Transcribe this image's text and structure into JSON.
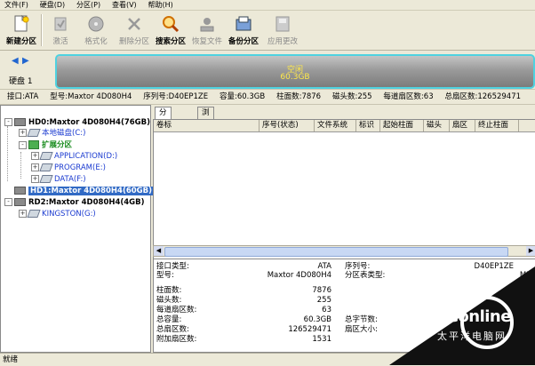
{
  "menu": [
    "文件(F)",
    "硬盘(D)",
    "分区(P)",
    "查看(V)",
    "帮助(H)"
  ],
  "toolbar": [
    {
      "label": "新建分区",
      "icon": "new-partition-icon",
      "enabled": true
    },
    {
      "label": "激活",
      "icon": "activate-icon",
      "enabled": false
    },
    {
      "label": "格式化",
      "icon": "format-icon",
      "enabled": false
    },
    {
      "label": "删除分区",
      "icon": "delete-partition-icon",
      "enabled": false
    },
    {
      "label": "搜索分区",
      "icon": "search-partition-icon",
      "enabled": true
    },
    {
      "label": "恢复文件",
      "icon": "restore-files-icon",
      "enabled": false
    },
    {
      "label": "备份分区",
      "icon": "backup-partition-icon",
      "enabled": true
    },
    {
      "label": "应用更改",
      "icon": "apply-changes-icon",
      "enabled": false
    }
  ],
  "diskbar": {
    "disk_label": "硬盘 1",
    "partition_name": "空闲",
    "partition_size": "60.3GB"
  },
  "infobar": [
    "接口:ATA",
    "型号:Maxtor 4D080H4",
    "序列号:D40EP1ZE",
    "容量:60.3GB",
    "柱面数:7876",
    "磁头数:255",
    "每道扇区数:63",
    "总扇区数:126529471"
  ],
  "tree": {
    "disks": [
      {
        "label": "HD0:Maxtor 4D080H4(76GB)"
      },
      {
        "label": "HD1:Maxtor 4D080H4(60GB)"
      },
      {
        "label": "RD2:Maxtor 4D080H4(4GB)"
      }
    ],
    "local_disk": "本地磁盘(C:)",
    "extended": "扩展分区",
    "application": "APPLICATION(D:)",
    "program": "PROGRAM(E:)",
    "data": "DATA(F:)",
    "kingston": "KINGSTON(G:)"
  },
  "tabs": [
    "分区参数",
    "浏览文件"
  ],
  "columns": [
    "卷标",
    "序号(状态)",
    "文件系统",
    "标识",
    "起始柱面",
    "磁头",
    "扇区",
    "终止柱面"
  ],
  "details": {
    "interface_label": "接口类型:",
    "interface_value": "ATA",
    "model_label": "型号:",
    "model_value": "Maxtor 4D080H4",
    "serial_label": "序列号:",
    "serial_value": "D40EP1ZE",
    "table_label": "分区表类型:",
    "table_value": "MB",
    "cyl_label": "柱面数:",
    "cyl_value": "7876",
    "heads_label": "磁头数:",
    "heads_value": "255",
    "spt_label": "每道扇区数:",
    "spt_value": "63",
    "cap_label": "总容量:",
    "cap_value": "60.3GB",
    "total_sec_label": "总扇区数:",
    "total_sec_value": "126529471",
    "extra_label": "附加扇区数:",
    "extra_value": "1531",
    "bytes_label": "总字节数:",
    "sector_size_label": "扇区大小:"
  },
  "status": "就绪",
  "watermark": {
    "brand": "PConline",
    "sub": "太平洋电脑网"
  }
}
